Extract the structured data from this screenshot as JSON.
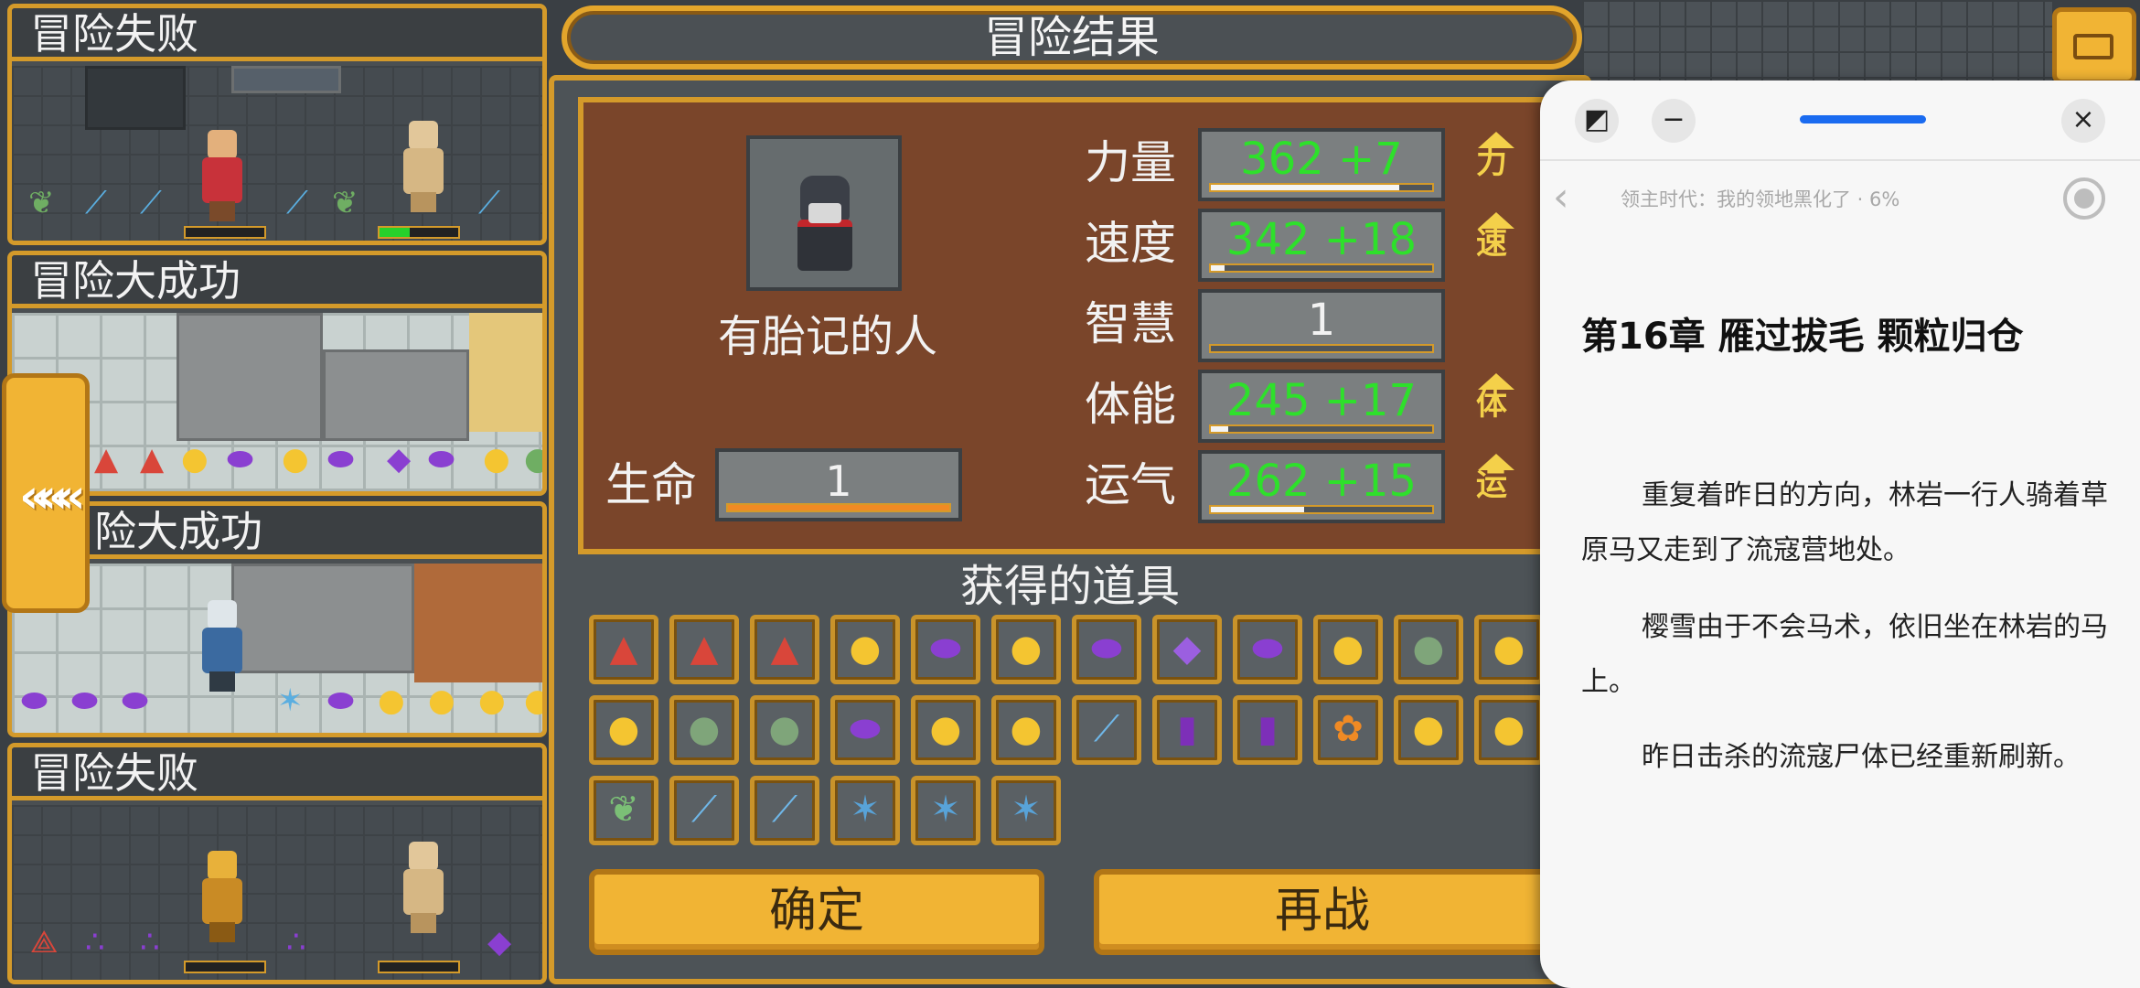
{
  "game": {
    "header_title": "冒险结果",
    "logs": [
      {
        "title": "冒险失败"
      },
      {
        "title": "冒险大成功"
      },
      {
        "title": "险大成功"
      },
      {
        "title": "冒险失败"
      }
    ],
    "back_tab_glyph": "«««",
    "character": {
      "name": "有胎记的人",
      "life_label": "生命",
      "life_value": "1",
      "life_fill": 1.0
    },
    "stats": [
      {
        "label": "力量",
        "value": "362 +7",
        "fill": 0.85,
        "color": "#2ee02b",
        "up_icon": "力"
      },
      {
        "label": "速度",
        "value": "342 +18",
        "fill": 0.06,
        "color": "#2ee02b",
        "up_icon": "速"
      },
      {
        "label": "智慧",
        "value": "1",
        "fill": 0.0,
        "color": "#f2f2f2",
        "up_icon": ""
      },
      {
        "label": "体能",
        "value": "245 +17",
        "fill": 0.08,
        "color": "#2ee02b",
        "up_icon": "体"
      },
      {
        "label": "运气",
        "value": "262 +15",
        "fill": 0.42,
        "color": "#2ee02b",
        "up_icon": "运"
      }
    ],
    "items_title": "获得的道具",
    "items": [
      "red-ore",
      "red-ore",
      "red-ore",
      "gold-ore",
      "purple-gem",
      "gold-ore",
      "purple-gem",
      "purple-crystal",
      "purple-gem",
      "gold-ore",
      "green-ore",
      "gold-ore",
      "gold-ore",
      "green-ore",
      "green-ore",
      "purple-gem",
      "gold-ore",
      "gold-ore",
      "blue-staff",
      "purple-potion",
      "purple-potion",
      "orange-flower",
      "gold-ore",
      "gold-ore",
      "green-leaf",
      "blue-staff",
      "blue-staff",
      "crystal-shard",
      "crystal-shard",
      "crystal-shard"
    ],
    "confirm_label": "确定",
    "retry_label": "再战"
  },
  "reader": {
    "book_info": "领主时代：我的领地黑化了 · 6%",
    "chapter_title": "第16章 雁过拔毛 颗粒归仓",
    "paragraphs": [
      "重复着昨日的方向，林岩一行人骑着草原马又走到了流寇营地处。",
      "樱雪由于不会马术，依旧坐在林岩的马上。",
      "昨日击杀的流寇尸体已经重新刷新。"
    ],
    "btn_minimize": "−",
    "btn_close": "×",
    "btn_split": "◩",
    "back_glyph": "‹"
  }
}
